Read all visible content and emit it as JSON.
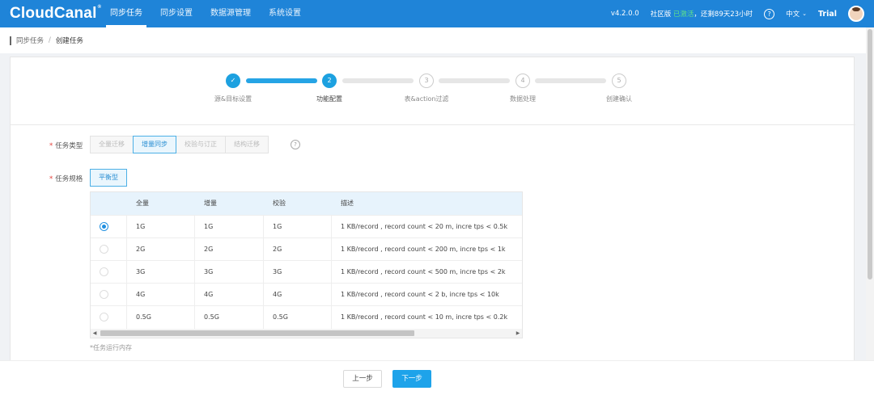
{
  "app": {
    "logo": "CloudCanal",
    "logo_mark": "®",
    "nav": [
      "同步任务",
      "同步设置",
      "数据源管理",
      "系统设置"
    ],
    "active_nav": "同步任务",
    "version": "v4.2.0.0",
    "edition_prefix": "社区版 ",
    "edition_status": "已激活",
    "edition_suffix": "，还剩89天23小时",
    "help_icon": "?",
    "language": "中文",
    "user": "Trial"
  },
  "breadcrumb": {
    "parent": "同步任务",
    "separator": "/",
    "current": "创建任务"
  },
  "steps": [
    {
      "index": "✓",
      "label": "源&目标设置",
      "status": "done"
    },
    {
      "index": "2",
      "label": "功能配置",
      "status": "active"
    },
    {
      "index": "3",
      "label": "表&action过滤",
      "status": "wait"
    },
    {
      "index": "4",
      "label": "数据处理",
      "status": "wait"
    },
    {
      "index": "5",
      "label": "创建确认",
      "status": "wait"
    }
  ],
  "form": {
    "task_type_label": "任务类型",
    "task_type_options": [
      "全量迁移",
      "增量同步",
      "校验与订正",
      "结构迁移"
    ],
    "task_type_selected": "增量同步",
    "task_spec_label": "任务规格",
    "task_spec_value": "平衡型",
    "required_mark": "*"
  },
  "spec_table": {
    "headers": [
      "全量",
      "增量",
      "校验",
      "描述"
    ],
    "selected_row": 0,
    "rows": [
      [
        "1G",
        "1G",
        "1G",
        "1 KB/record , record count < 20 m, incre tps < 0.5k"
      ],
      [
        "2G",
        "2G",
        "2G",
        "1 KB/record , record count < 200 m, incre tps < 1k"
      ],
      [
        "3G",
        "3G",
        "3G",
        "1 KB/record , record count < 500 m, incre tps < 2k"
      ],
      [
        "4G",
        "4G",
        "4G",
        "1 KB/record , record count < 2 b, incre tps < 10k"
      ],
      [
        "0.5G",
        "0.5G",
        "0.5G",
        "1 KB/record , record count < 10 m, incre tps < 0.2k"
      ]
    ],
    "note": "*任务运行内存"
  },
  "footer": {
    "prev": "上一步",
    "next": "下一步"
  },
  "colors": {
    "topbar": "#1f84d8",
    "accent": "#1ea3ea",
    "required": "#e4403a"
  }
}
